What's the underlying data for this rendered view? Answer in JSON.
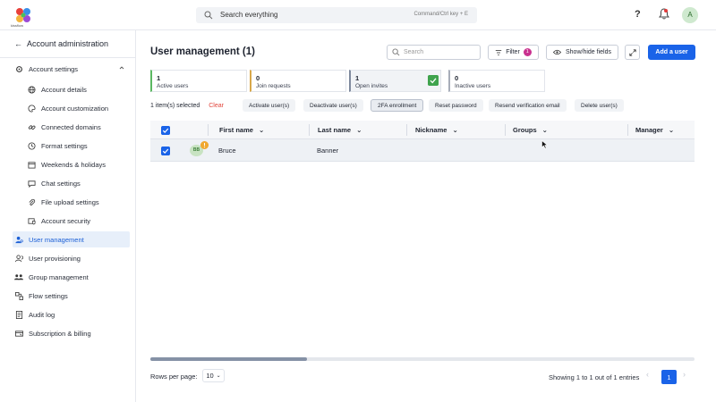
{
  "app": {
    "logo_text": "kissflow"
  },
  "topbar": {
    "search_placeholder": "Search everything",
    "search_shortcut": "Command/Ctrl key + E",
    "help_label": "?",
    "avatar_initial": "A"
  },
  "sidebar": {
    "title": "Account administration",
    "section_label": "Account settings",
    "sub_items": [
      {
        "label": "Account details",
        "icon": "globe-icon"
      },
      {
        "label": "Account customization",
        "icon": "palette-icon"
      },
      {
        "label": "Connected domains",
        "icon": "link-icon"
      },
      {
        "label": "Format settings",
        "icon": "clock-icon"
      },
      {
        "label": "Weekends & holidays",
        "icon": "calendar-icon"
      },
      {
        "label": "Chat settings",
        "icon": "chat-icon"
      },
      {
        "label": "File upload settings",
        "icon": "paperclip-icon"
      },
      {
        "label": "Account security",
        "icon": "shield-icon"
      }
    ],
    "items": [
      {
        "label": "User management",
        "icon": "user-gear-icon",
        "active": true
      },
      {
        "label": "User provisioning",
        "icon": "user-sync-icon"
      },
      {
        "label": "Group management",
        "icon": "group-icon"
      },
      {
        "label": "Flow settings",
        "icon": "flow-icon"
      },
      {
        "label": "Audit log",
        "icon": "document-icon"
      },
      {
        "label": "Subscription & billing",
        "icon": "billing-icon"
      }
    ]
  },
  "main": {
    "title": "User management (1)",
    "search_placeholder": "Search",
    "filter_label": "Filter",
    "filter_count": "1",
    "fields_label": "Show/hide fields",
    "add_label": "Add a user"
  },
  "stats": [
    {
      "count": "1",
      "label": "Active users"
    },
    {
      "count": "0",
      "label": "Join requests"
    },
    {
      "count": "1",
      "label": "Open invites"
    },
    {
      "count": "0",
      "label": "Inactive users"
    }
  ],
  "selection": {
    "count_text": "1 item(s) selected",
    "clear_label": "Clear"
  },
  "actions": [
    "Activate user(s)",
    "Deactivate user(s)",
    "2FA enrollment",
    "Reset password",
    "Resend verification email",
    "Delete user(s)"
  ],
  "table": {
    "columns": [
      "First name",
      "Last name",
      "Nickname",
      "Groups",
      "Manager"
    ],
    "rows": [
      {
        "initials": "BB",
        "first_name": "Bruce",
        "last_name": "Banner",
        "nickname": "",
        "groups": "",
        "manager": ""
      }
    ]
  },
  "footer": {
    "rows_per_page_label": "Rows per page:",
    "rows_per_page_value": "10",
    "entries_text": "Showing 1 to 1 out of 1 entries",
    "current_page": "1"
  },
  "colors": {
    "primary": "#1a63e8",
    "active_bg": "#e7effa",
    "danger": "#e2443a"
  }
}
